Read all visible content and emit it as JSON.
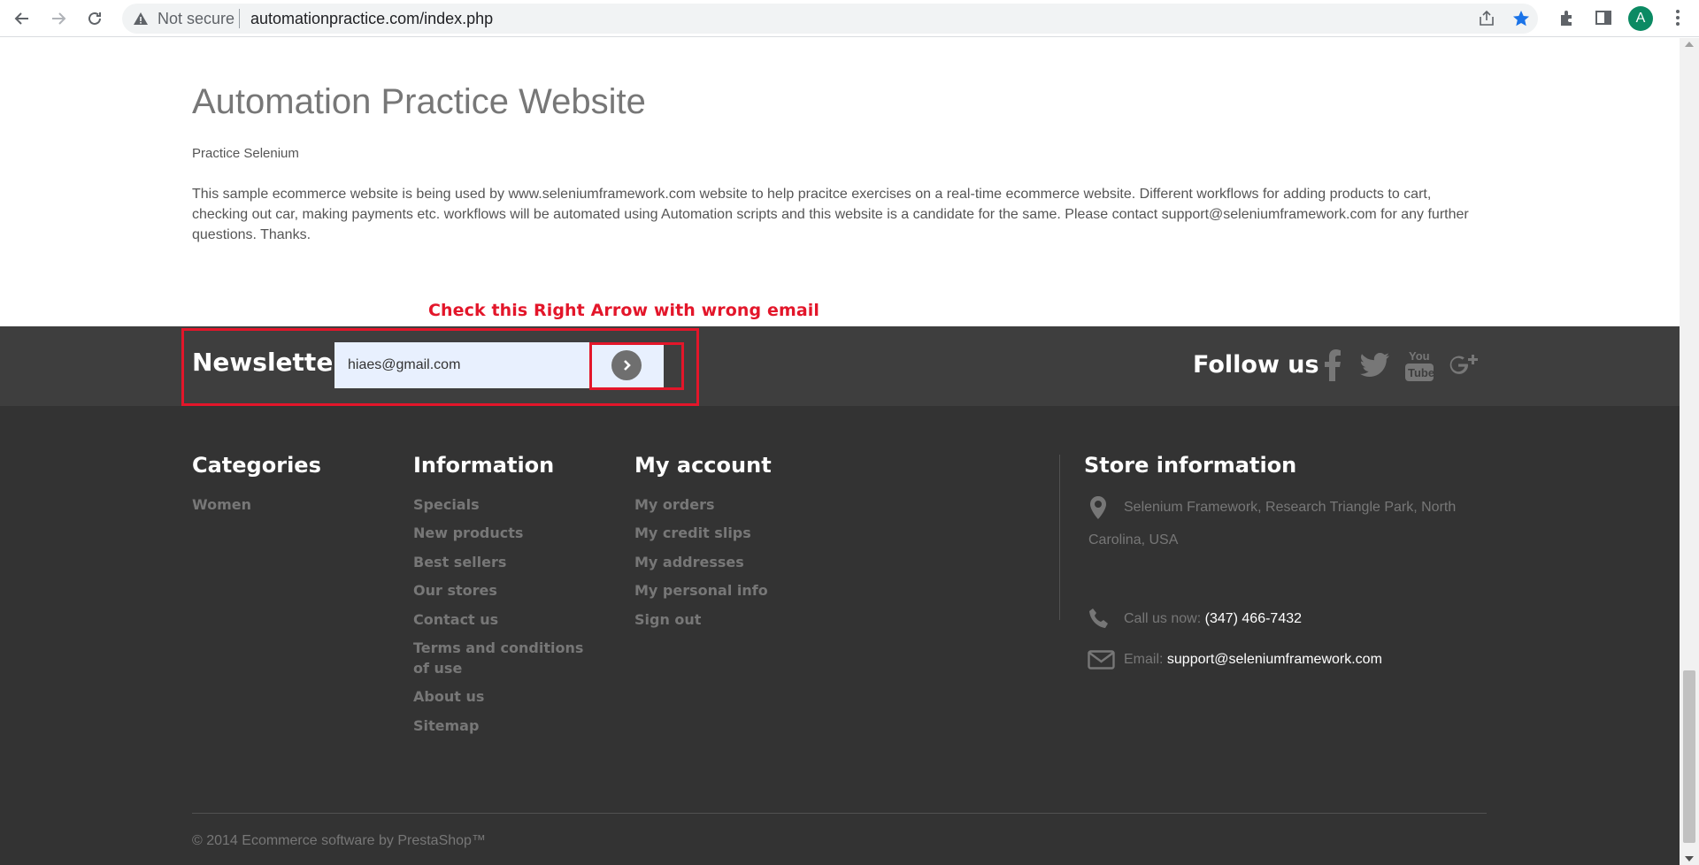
{
  "browser": {
    "security_label": "Not secure",
    "url": "automationpractice.com/index.php",
    "profile_initial": "A"
  },
  "page": {
    "title": "Automation Practice Website",
    "subtitle": "Practice Selenium",
    "description": "This sample ecommerce website is being used by www.seleniumframework.com website to help pracitce exercises on a real-time ecommerce website. Different workflows for adding products to cart, checking out car, making payments etc. workflows will be automated using Automation scripts and this website is a candidate for the same. Please contact support@seleniumframework.com for any further questions. Thanks."
  },
  "annotation": {
    "label": "Check this Right Arrow with wrong email",
    "color": "#e3162a"
  },
  "newsletter": {
    "title": "Newsletter",
    "email_value": "hiaes@gmail.com",
    "submit_icon": "chevron-right-circle-icon"
  },
  "follow": {
    "title": "Follow us",
    "networks": [
      "facebook-icon",
      "twitter-icon",
      "youtube-icon",
      "google-plus-icon"
    ]
  },
  "footer": {
    "categories": {
      "title": "Categories",
      "links": [
        "Women"
      ]
    },
    "information": {
      "title": "Information",
      "links": [
        "Specials",
        "New products",
        "Best sellers",
        "Our stores",
        "Contact us",
        "Terms and conditions of use",
        "About us",
        "Sitemap"
      ]
    },
    "account": {
      "title": "My account",
      "links": [
        "My orders",
        "My credit slips",
        "My addresses",
        "My personal info",
        "Sign out"
      ]
    },
    "store": {
      "title": "Store information",
      "address": "Selenium Framework, Research Triangle Park, North Carolina, USA",
      "phone_label": "Call us now:",
      "phone": "(347) 466-7432",
      "email_label": "Email:",
      "email": "support@seleniumframework.com"
    },
    "copyright": "© 2014 Ecommerce software by PrestaShop™"
  },
  "colors": {
    "footer_bg": "#333333",
    "newsletter_bg": "#3e3e3e",
    "annotation_red": "#e3162a"
  }
}
